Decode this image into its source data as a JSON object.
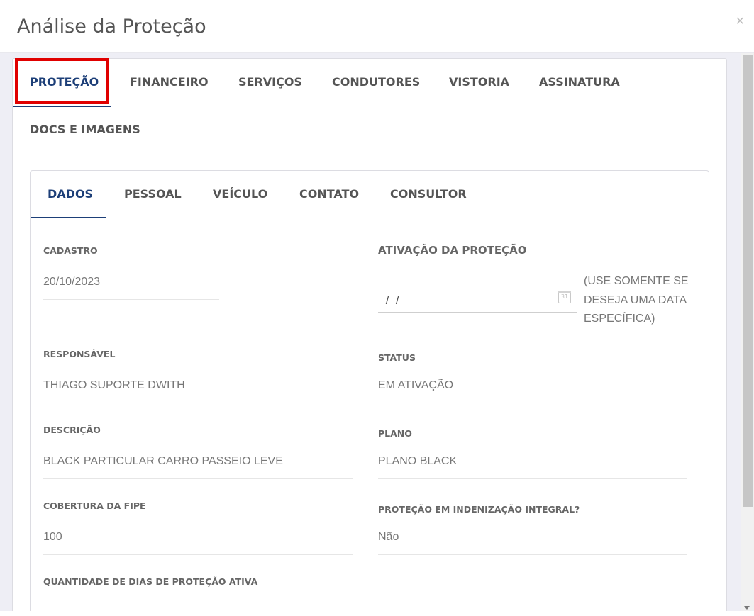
{
  "modal": {
    "title": "Análise da Proteção",
    "close_label": "×"
  },
  "outer_tabs": [
    {
      "label": "PROTEÇÃO",
      "active": true
    },
    {
      "label": "FINANCEIRO",
      "active": false
    },
    {
      "label": "SERVIÇOS",
      "active": false
    },
    {
      "label": "CONDUTORES",
      "active": false
    },
    {
      "label": "VISTORIA",
      "active": false
    },
    {
      "label": "ASSINATURA",
      "active": false
    },
    {
      "label": "DOCS E IMAGENS",
      "active": false
    }
  ],
  "inner_tabs": [
    {
      "label": "DADOS",
      "active": true
    },
    {
      "label": "PESSOAL",
      "active": false
    },
    {
      "label": "VEÍCULO",
      "active": false
    },
    {
      "label": "CONTATO",
      "active": false
    },
    {
      "label": "CONSULTOR",
      "active": false
    }
  ],
  "fields": {
    "cadastro": {
      "label": "CADASTRO",
      "value": "20/10/2023"
    },
    "ativacao": {
      "label": "ATIVAÇÃO DA PROTEÇÃO",
      "value": " /  /",
      "hint": "(USE SOMENTE SE DESEJA UMA DATA ESPECÍFICA)"
    },
    "responsavel": {
      "label": "RESPONSÁVEL",
      "value": "THIAGO SUPORTE DWITH"
    },
    "status": {
      "label": "STATUS",
      "value": "EM ATIVAÇÃO"
    },
    "descricao": {
      "label": "DESCRIÇÃO",
      "value": "BLACK PARTICULAR CARRO PASSEIO LEVE"
    },
    "plano": {
      "label": "PLANO",
      "value": "PLANO BLACK"
    },
    "cobertura_fipe": {
      "label": "COBERTURA DA FIPE",
      "value": "100"
    },
    "indenizacao_integral": {
      "label": "PROTEÇÃO EM INDENIZAÇÃO INTEGRAL?",
      "value": "Não"
    },
    "dias_protecao": {
      "label": "QUANTIDADE DE DIAS DE PROTEÇÃO ATIVA"
    }
  },
  "calendar_icon_text": "31",
  "colors": {
    "active_tab": "#1d3f78",
    "highlight": "#e00000",
    "body_bg": "#eeeef5"
  }
}
